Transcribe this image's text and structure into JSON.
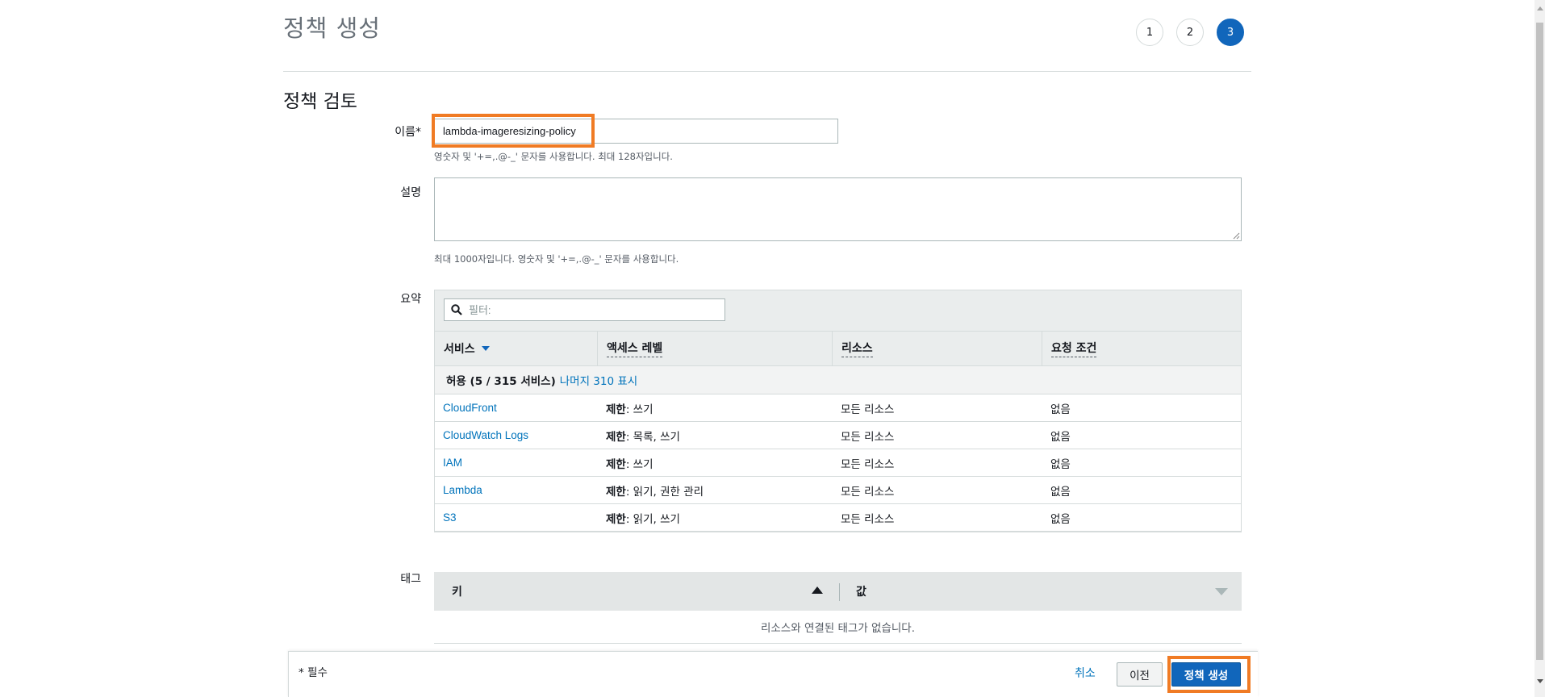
{
  "header": {
    "title": "정책 생성",
    "steps": [
      "1",
      "2",
      "3"
    ],
    "active_step": "3"
  },
  "section_title": "정책 검토",
  "form": {
    "name_label": "이름*",
    "name_value": "lambda-imageresizing-policy",
    "name_hint": "영숫자 및 '+=,.@-_' 문자를 사용합니다. 최대 128자입니다.",
    "description_label": "설명",
    "description_value": "",
    "description_hint": "최대 1000자입니다. 영숫자 및 '+=,.@-_' 문자를 사용합니다.",
    "summary_label": "요약",
    "tags_label": "태그"
  },
  "summary": {
    "filter_placeholder": "필터:",
    "columns": [
      "서비스",
      "액세스 레벨",
      "리소스",
      "요청 조건"
    ],
    "group_label": "허용 (5 / 315 서비스)",
    "group_more": "나머지 310 표시",
    "rows": [
      {
        "service": "CloudFront",
        "access_prefix": "제한",
        "access_detail": ": 쓰기",
        "resource": "모든 리소스",
        "condition": "없음"
      },
      {
        "service": "CloudWatch Logs",
        "access_prefix": "제한",
        "access_detail": ": 목록, 쓰기",
        "resource": "모든 리소스",
        "condition": "없음"
      },
      {
        "service": "IAM",
        "access_prefix": "제한",
        "access_detail": ": 쓰기",
        "resource": "모든 리소스",
        "condition": "없음"
      },
      {
        "service": "Lambda",
        "access_prefix": "제한",
        "access_detail": ": 읽기, 권한 관리",
        "resource": "모든 리소스",
        "condition": "없음"
      },
      {
        "service": "S3",
        "access_prefix": "제한",
        "access_detail": ": 읽기, 쓰기",
        "resource": "모든 리소스",
        "condition": "없음"
      }
    ]
  },
  "tags": {
    "key_header": "키",
    "value_header": "값",
    "empty_message": "리소스와 연결된 태그가 없습니다."
  },
  "footer": {
    "required_note": "* 필수",
    "cancel_label": "취소",
    "previous_label": "이전",
    "create_label": "정책 생성"
  },
  "colors": {
    "highlight": "#f07b24",
    "primary": "#1166bb",
    "link": "#0073bb"
  }
}
